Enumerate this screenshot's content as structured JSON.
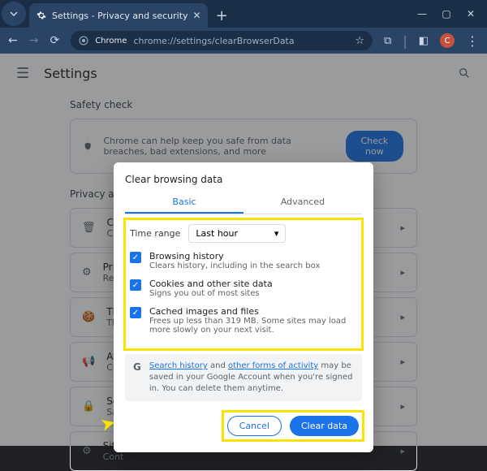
{
  "window": {
    "tab_title": "Settings - Privacy and security",
    "omnibox_chip": "Chrome",
    "omnibox_url": "chrome://settings/clearBrowserData",
    "avatar_letter": "C"
  },
  "header": {
    "title": "Settings"
  },
  "safety": {
    "section_label": "Safety check",
    "text": "Chrome can help keep you safe from data breaches, bad extensions, and more",
    "button": "Check now"
  },
  "privacy": {
    "section_label": "Privacy and security",
    "rows": [
      {
        "title": "Clear",
        "sub": "Clear"
      },
      {
        "title": "Priva",
        "sub": "Revi"
      },
      {
        "title": "Third",
        "sub": "Third"
      },
      {
        "title": "Ad p",
        "sub": "Cust"
      },
      {
        "title": "Secu",
        "sub": "Safe"
      },
      {
        "title": "Site",
        "sub": "Cont"
      }
    ]
  },
  "dialog": {
    "title": "Clear browsing data",
    "tabs": {
      "basic": "Basic",
      "advanced": "Advanced"
    },
    "time_range_label": "Time range",
    "time_range_value": "Last hour",
    "items": [
      {
        "title": "Browsing history",
        "sub": "Clears history, including in the search box"
      },
      {
        "title": "Cookies and other site data",
        "sub": "Signs you out of most sites"
      },
      {
        "title": "Cached images and files",
        "sub": "Frees up less than 319 MB. Some sites may load more slowly on your next visit."
      }
    ],
    "info_pre": "",
    "info_link1": "Search history",
    "info_mid": " and ",
    "info_link2": "other forms of activity",
    "info_post": " may be saved in your Google Account when you're signed in. You can delete them anytime.",
    "cancel": "Cancel",
    "clear": "Clear data"
  }
}
